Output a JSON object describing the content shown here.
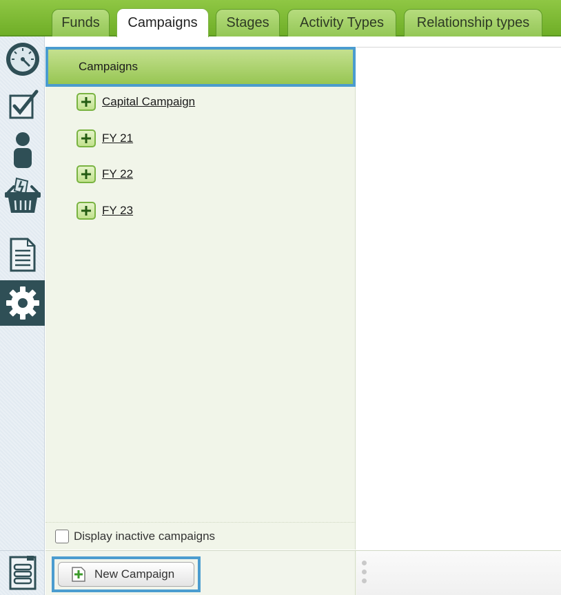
{
  "tabs": [
    {
      "label": "Funds",
      "active": false
    },
    {
      "label": "Campaigns",
      "active": true
    },
    {
      "label": "Stages",
      "active": false
    },
    {
      "label": "Activity Types",
      "active": false
    },
    {
      "label": "Relationship types",
      "active": false
    }
  ],
  "rail": {
    "items": [
      {
        "icon": "dashboard-gauge-icon"
      },
      {
        "icon": "checkbox-task-icon"
      },
      {
        "icon": "person-icon"
      },
      {
        "icon": "donation-basket-icon"
      },
      {
        "icon": "document-icon"
      },
      {
        "icon": "settings-gear-icon",
        "active": true
      }
    ],
    "bottom_icon": "menu-list-icon"
  },
  "tree": {
    "root_label": "Campaigns",
    "items": [
      {
        "label": "Capital Campaign"
      },
      {
        "label": "FY 21"
      },
      {
        "label": "FY 22"
      },
      {
        "label": "FY 23"
      }
    ]
  },
  "inactive_toggle": {
    "label": "Display inactive campaigns",
    "checked": false
  },
  "toolbar": {
    "new_button_label": "New Campaign"
  },
  "colors": {
    "accent_green": "#8fc744",
    "selection_blue": "#4b9ccf",
    "rail_active": "#2f4f56"
  }
}
